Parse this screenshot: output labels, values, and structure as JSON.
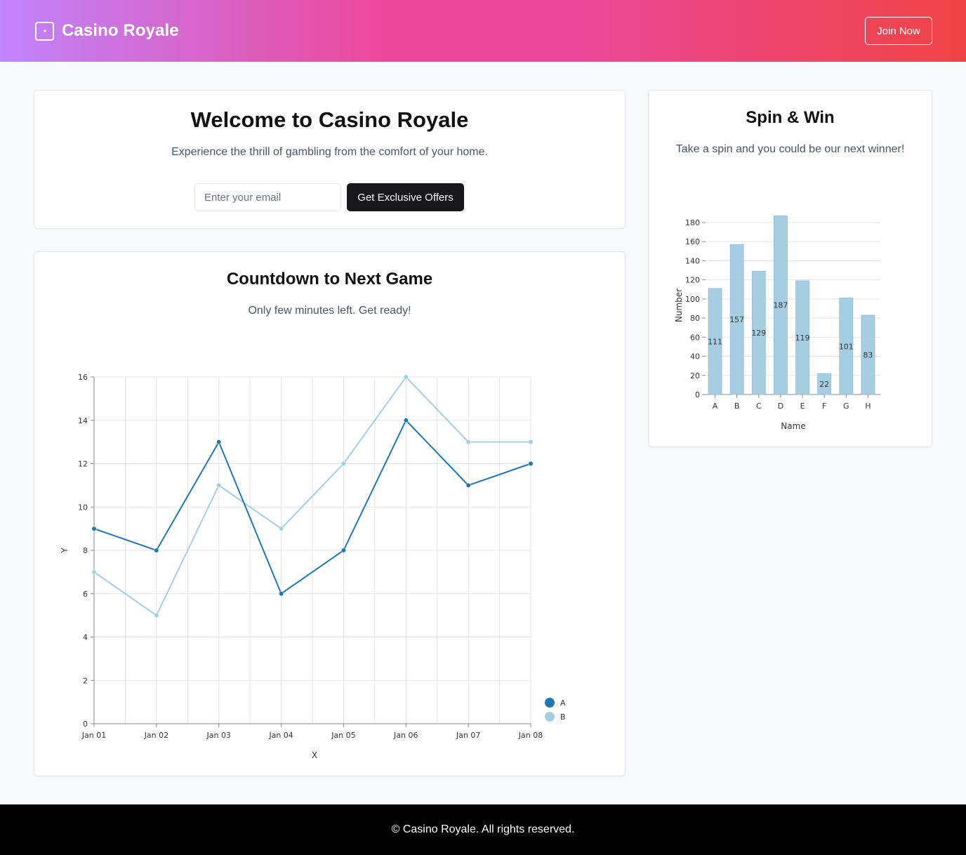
{
  "header": {
    "brand": "Casino Royale",
    "brand_icon": "dice-icon",
    "join_label": "Join Now"
  },
  "welcome": {
    "title": "Welcome to Casino Royale",
    "subtitle": "Experience the thrill of gambling from the comfort of your home.",
    "email_placeholder": "Enter your email",
    "email_value": "",
    "cta_label": "Get Exclusive Offers"
  },
  "countdown": {
    "title": "Countdown to Next Game",
    "subtitle": "Only few minutes left. Get ready!"
  },
  "spin": {
    "title": "Spin & Win",
    "subtitle": "Take a spin and you could be our next winner!"
  },
  "footer": {
    "text": "© Casino Royale. All rights reserved."
  },
  "chart_data": [
    {
      "type": "line",
      "x": [
        "Jan 01",
        "Jan 02",
        "Jan 03",
        "Jan 04",
        "Jan 05",
        "Jan 06",
        "Jan 07",
        "Jan 08"
      ],
      "series": [
        {
          "name": "A",
          "color": "#1f77b4",
          "values": [
            9,
            8,
            13,
            6,
            8,
            14,
            11,
            12
          ]
        },
        {
          "name": "B",
          "color": "#a6cee3",
          "values": [
            7,
            5,
            11,
            9,
            12,
            16,
            13,
            13
          ]
        }
      ],
      "xlabel": "X",
      "ylabel": "Y",
      "ylim": [
        0,
        16
      ],
      "yticks": [
        0,
        2,
        4,
        6,
        8,
        10,
        12,
        14,
        16
      ],
      "grid": true,
      "legend": "bottom-right"
    },
    {
      "type": "bar",
      "categories": [
        "A",
        "B",
        "C",
        "D",
        "E",
        "F",
        "G",
        "H"
      ],
      "values": [
        111,
        157,
        129,
        187,
        119,
        22,
        101,
        83
      ],
      "color": "#a6cee3",
      "xlabel": "Name",
      "ylabel": "Number",
      "ylim": [
        0,
        180
      ],
      "yticks": [
        0,
        20,
        40,
        60,
        80,
        100,
        120,
        140,
        160,
        180
      ],
      "grid": true,
      "data_labels": true
    }
  ]
}
